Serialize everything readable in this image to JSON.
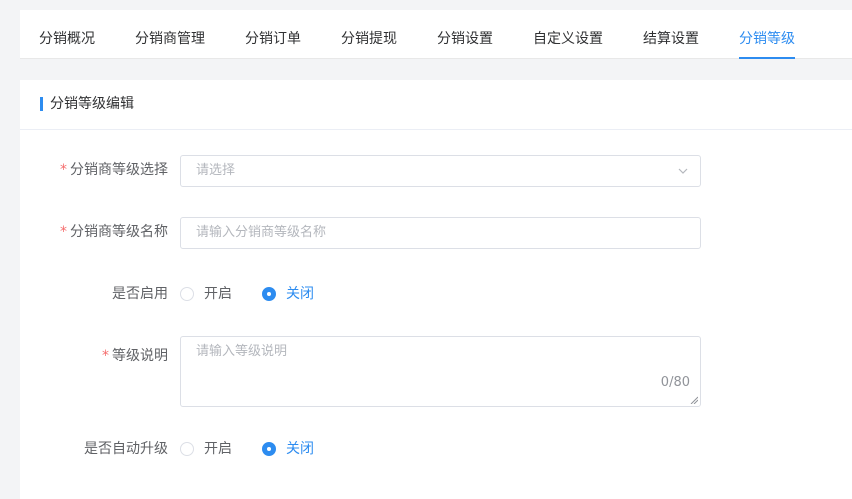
{
  "tabs": [
    {
      "label": "分销概况"
    },
    {
      "label": "分销商管理"
    },
    {
      "label": "分销订单"
    },
    {
      "label": "分销提现"
    },
    {
      "label": "分销设置"
    },
    {
      "label": "自定义设置"
    },
    {
      "label": "结算设置"
    },
    {
      "label": "分销等级"
    }
  ],
  "active_tab": "分销等级",
  "panel": {
    "title": "分销等级编辑"
  },
  "form": {
    "required_mark": "*",
    "level_select": {
      "label": "分销商等级选择",
      "placeholder": "请选择",
      "icon": "chevron-down-icon"
    },
    "level_name": {
      "label": "分销商等级名称",
      "placeholder": "请输入分销商等级名称"
    },
    "enabled": {
      "label": "是否启用",
      "options": [
        "开启",
        "关闭"
      ],
      "selected": "关闭"
    },
    "description": {
      "label": "等级说明",
      "placeholder": "请输入等级说明",
      "counter": "0/80"
    },
    "auto_upgrade": {
      "label": "是否自动升级",
      "options": [
        "开启",
        "关闭"
      ],
      "selected": "关闭"
    }
  },
  "colors": {
    "accent": "#2d8cf0",
    "required": "#f56c6c",
    "border": "#dcdfe6",
    "background": "#f3f4f6"
  }
}
